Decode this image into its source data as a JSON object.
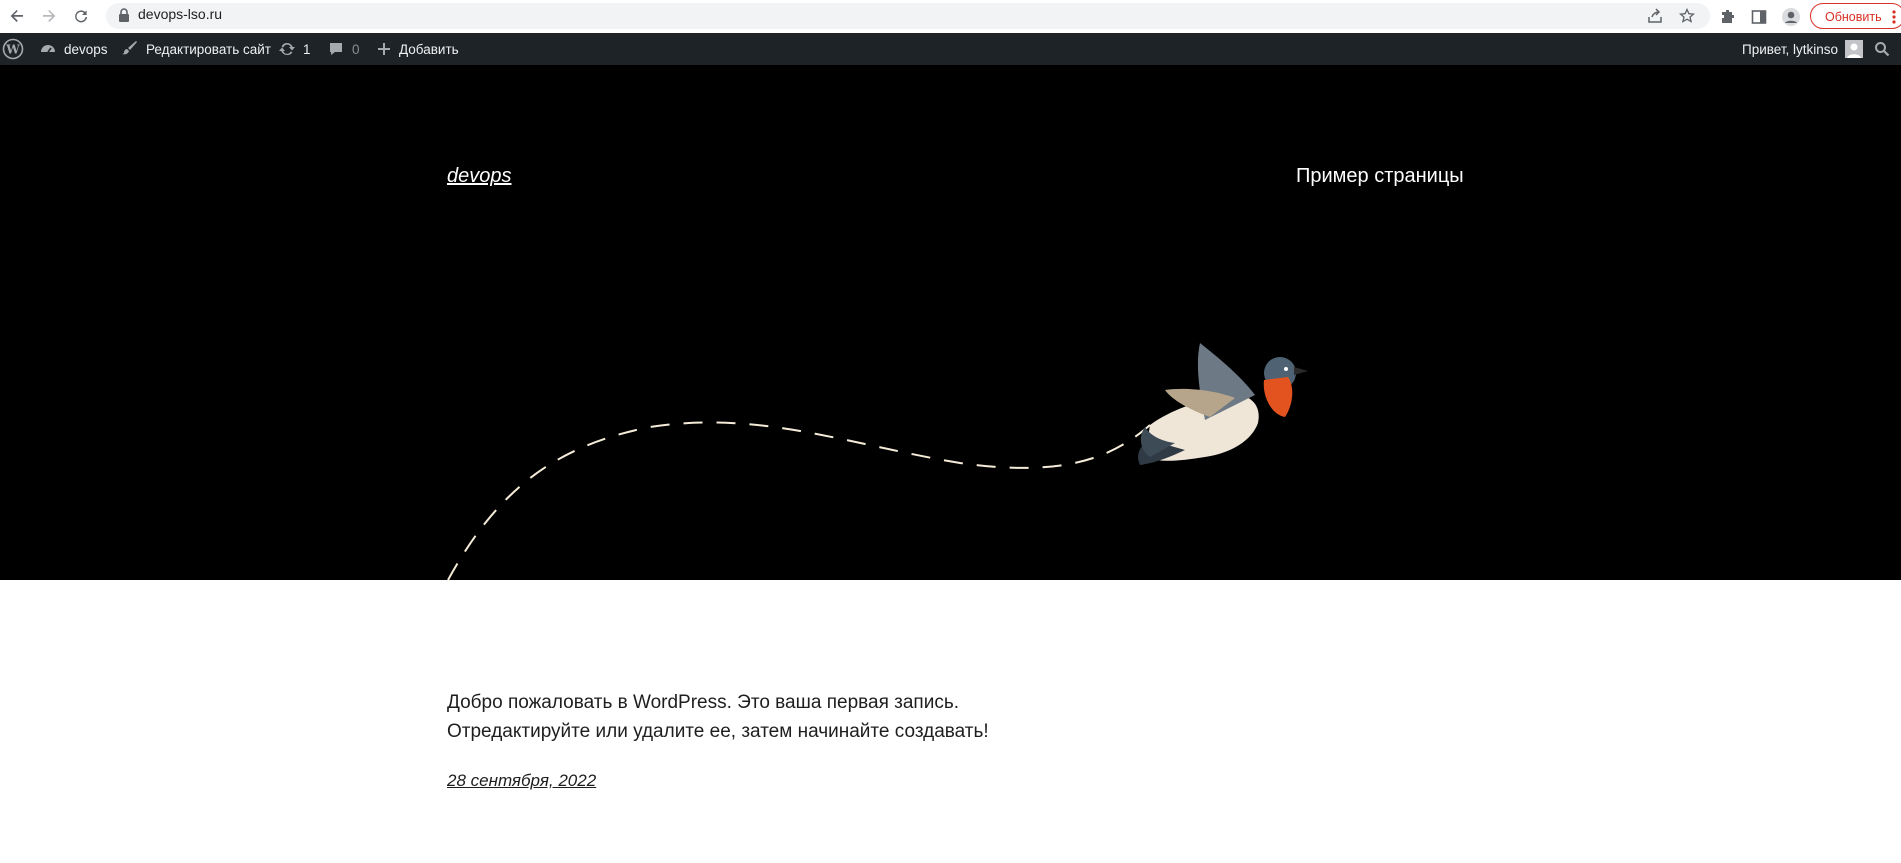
{
  "browser": {
    "url": "devops-lso.ru",
    "update_button": "Обновить"
  },
  "admin_bar": {
    "site_name": "devops",
    "edit_site": "Редактировать сайт",
    "updates_count": "1",
    "comments_count": "0",
    "add_new": "Добавить",
    "greeting": "Привет, lytkinso"
  },
  "header": {
    "site_title": "devops",
    "nav_page": "Пример страницы"
  },
  "post": {
    "excerpt": "Добро пожаловать в WordPress. Это ваша первая запись. Отредактируйте или удалите ее, затем начинайте создавать!",
    "date": "28 сентября, 2022"
  },
  "colors": {
    "admin_bar_bg": "#1d2327",
    "hero_bg": "#000000",
    "update_accent": "#d93025"
  },
  "icons": [
    "back-arrow-icon",
    "forward-arrow-icon",
    "reload-icon",
    "lock-icon",
    "share-icon",
    "star-icon",
    "extensions-icon",
    "side-panel-icon",
    "profile-icon",
    "more-vert-icon",
    "wordpress-logo-icon",
    "dashboard-icon",
    "brush-icon",
    "updates-icon",
    "comment-icon",
    "plus-icon",
    "search-icon"
  ]
}
